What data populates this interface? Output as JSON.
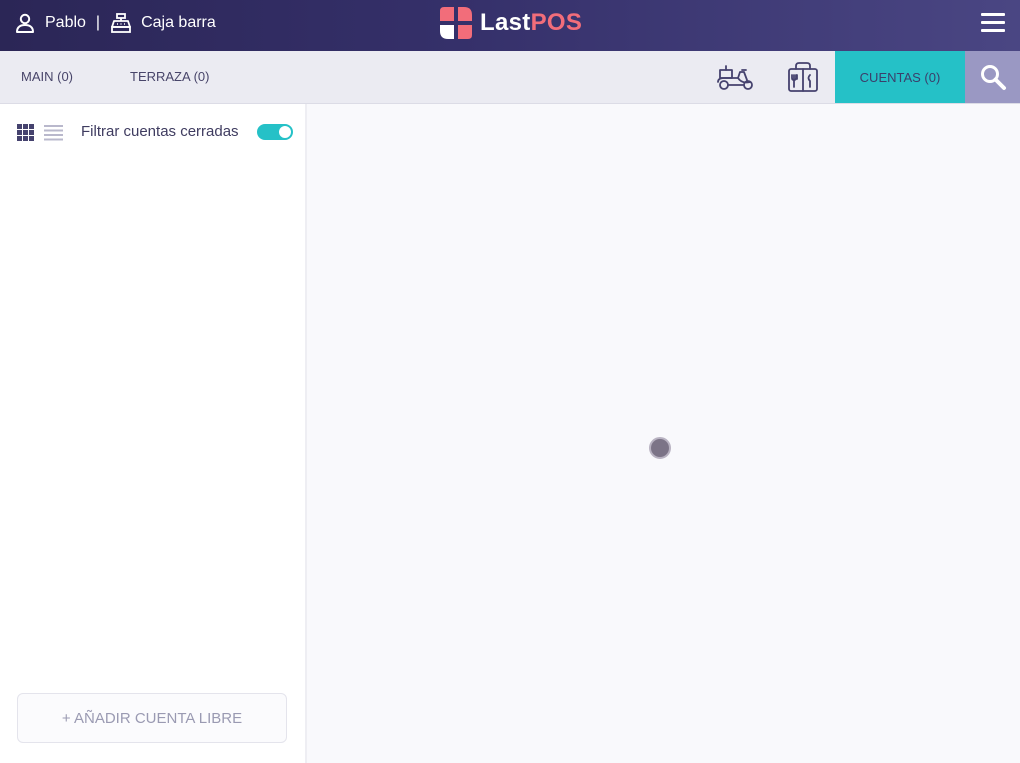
{
  "header": {
    "user_icon": "person-icon",
    "user_name": "Pablo",
    "separator": "|",
    "register_icon": "cash-register-icon",
    "register_name": "Caja barra",
    "logo": {
      "text_last": "Last",
      "text_pos": "POS"
    },
    "menu_icon": "hamburger-menu-icon"
  },
  "tabs": {
    "zones": [
      {
        "label": "MAIN (0)"
      },
      {
        "label": "TERRAZA (0)"
      }
    ],
    "delivery_icon": "delivery-scooter-icon",
    "takeaway_icon": "takeaway-bag-icon",
    "accounts_label": "CUENTAS (0)",
    "search_icon": "search-icon"
  },
  "sidebar": {
    "grid_view_icon": "grid-view-icon",
    "list_view_icon": "list-view-icon",
    "filter_label": "Filtrar cuentas cerradas",
    "filter_enabled": true,
    "add_button_label": "+ AÑADIR CUENTA LIBRE"
  },
  "colors": {
    "header_bg": "#2b2656",
    "accent_teal": "#25c1c7",
    "search_bg": "#9a98c3",
    "logo_red": "#f26d7a"
  }
}
